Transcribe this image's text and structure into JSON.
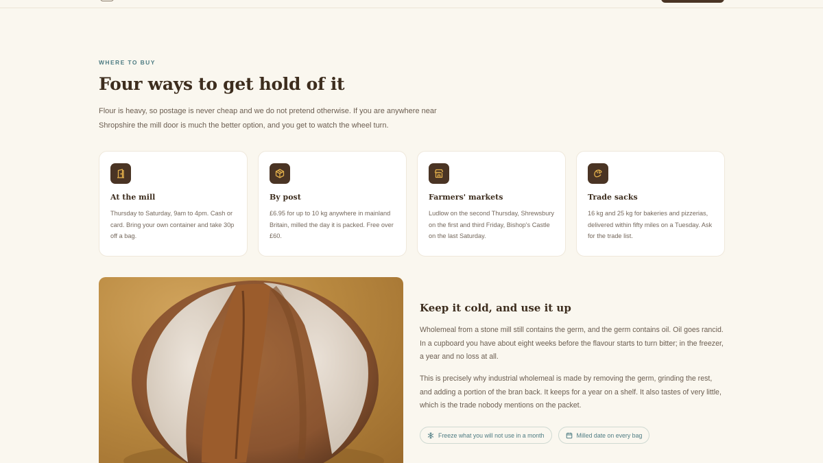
{
  "section": {
    "eyebrow": "WHERE TO BUY",
    "heading": "Four ways to get hold of it",
    "intro": "Flour is heavy, so postage is never cheap and we do not pretend otherwise. If you are anywhere near Shropshire the mill door is much the better option, and you get to watch the wheel turn."
  },
  "cards": [
    {
      "icon": "door-icon",
      "title": "At the mill",
      "body": "Thursday to Saturday, 9am to 4pm. Cash or card. Bring your own container and take 30p off a bag."
    },
    {
      "icon": "parcel-icon",
      "title": "By post",
      "body": "£6.95 for up to 10 kg anywhere in mainland Britain, milled the day it is packed. Free over £60."
    },
    {
      "icon": "market-stall-icon",
      "title": "Farmers' markets",
      "body": "Ludlow on the second Thursday, Shrewsbury on the first and third Friday, Bishop's Castle on the last Saturday."
    },
    {
      "icon": "croissant-icon",
      "title": "Trade sacks",
      "body": "16 kg and 25 kg for bakeries and pizzerias, delivered within fifty miles on a Tuesday. Ask for the trade list."
    }
  ],
  "storage": {
    "title": "Keep it cold, and use it up",
    "paragraph_1": "Wholemeal from a stone mill still contains the germ, and the germ contains oil. Oil goes rancid. In a cupboard you have about eight weeks before the flavour starts to turn bitter; in the freezer, a year and no loss at all.",
    "paragraph_2": "This is precisely why industrial wholemeal is made by removing the germ, grinding the rest, and adding a portion of the bran back. It keeps for a year on a shelf. It also tastes of very little, which is the trade nobody mentions on the packet.",
    "chips": [
      {
        "icon": "snowflake-icon",
        "label": "Freeze what you will not use in a month"
      },
      {
        "icon": "calendar-icon",
        "label": "Milled date on every bag"
      }
    ]
  },
  "colors": {
    "background": "#faf7ef",
    "accent_dark": "#4a3424",
    "icon_gold": "#e3b04b",
    "teal": "#4e7c83"
  }
}
